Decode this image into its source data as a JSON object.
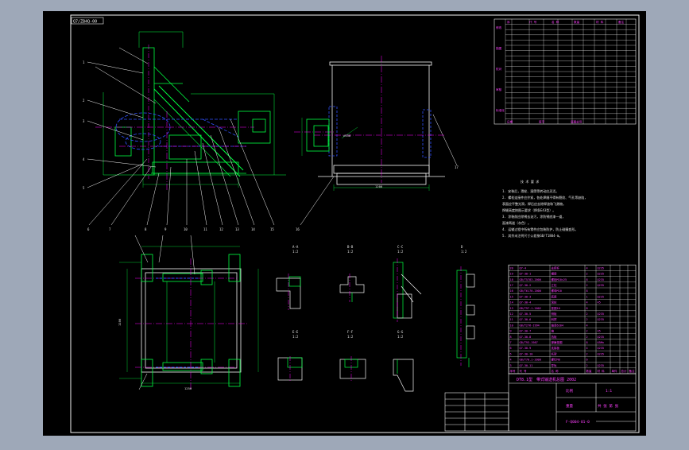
{
  "colors": {
    "window_bg": "#9ea8b8",
    "canvas_bg": "#000000",
    "frame": "#f5f5f5",
    "part": "#00ff40",
    "dim": "#00ff40",
    "hidden": "#3050ff",
    "center": "#ff00ff",
    "text": "#e8e8e8",
    "table": "#f0f0f0",
    "table_text": "#ff40ff",
    "accent": "#ffff00"
  },
  "drawing": {
    "title_tag": "Q7/ZB4Q-00",
    "title_block": {
      "drawing_title": "DT8.1型　带式输送机总图 2002",
      "scale_label": "比例",
      "scale_value": "1:1",
      "sheet_label": "共 张 第 张",
      "drawing_number": "F-Q004-01-0",
      "weight_label": "重量"
    },
    "notes": {
      "heading": "技 术 要 求",
      "lines": [
        "1. 安装后，滑轮、滚筒等转动应灵活。",
        "2. 螺栓连接件应拧紧，各处焊缝不得有裂纹、气孔等缺陷，",
        "   表面应平整光滑，焊后应去除焊渣和飞溅物。",
        "   焊缝高度按图示要求（焊条E43型）。",
        "3. 涂装前应除锈去油污，涂防锈底漆一道，",
        "   面漆两道（灰色）。",
        "4. 运输过程中所有零件应包装防护，防止碰撞变形。",
        "5. 其余未注明尺寸公差按GB/T1804-m。"
      ]
    },
    "section_labels": [
      {
        "id": "A-A",
        "scale": "1:2"
      },
      {
        "id": "B-B",
        "scale": "1:2"
      },
      {
        "id": "C-C",
        "scale": "1:2"
      },
      {
        "id": "D",
        "scale": "1:2"
      },
      {
        "id": "E-E",
        "scale": "1:2"
      },
      {
        "id": "F-F",
        "scale": "1:2"
      },
      {
        "id": "G-G",
        "scale": "1:2"
      }
    ],
    "balloons_top": [
      "1",
      "2",
      "3",
      "4",
      "5",
      "6",
      "7",
      "8",
      "9",
      "10",
      "11",
      "12",
      "13",
      "14",
      "15",
      "16",
      "17",
      "18",
      "19",
      "20"
    ],
    "dimensions": {
      "front_width": "1400",
      "side_width": "1200",
      "plan_height": "1100",
      "plan_width": "1250",
      "side_height": "φ 75",
      "side_gap": "∅150"
    },
    "revision_table": {
      "headers": [
        "序",
        "代 号",
        "名 称",
        "数量",
        "材 料",
        "备注"
      ],
      "groups": [
        "修改",
        "描图",
        "校对",
        "审核",
        "标准化"
      ],
      "footer": [
        "日期",
        "签字",
        "底图总号"
      ]
    },
    "parts_list": {
      "headers": [
        "序号",
        "代 号",
        "名 称",
        "数量",
        "材 料",
        "单件",
        "总计",
        "备注"
      ],
      "rows": [
        [
          "20",
          "Q7-4",
          "支撑杆",
          "4",
          "Q235",
          "",
          "",
          ""
        ],
        [
          "19",
          "Q7-30-1",
          "横梁",
          "2",
          "Q235",
          "",
          "",
          ""
        ],
        [
          "18",
          "GB/T5783-2000",
          "螺栓M10×25",
          "8",
          "Q235",
          "",
          "",
          ""
        ],
        [
          "17",
          "Q7-30-2",
          "立柱",
          "2",
          "Q235",
          "",
          "",
          ""
        ],
        [
          "16",
          "GB/T6170-2000",
          "螺母M10",
          "8",
          "",
          "",
          "",
          ""
        ],
        [
          "15",
          "Q7-30-3",
          "底座",
          "1",
          "Q235",
          "",
          "",
          ""
        ],
        [
          "14",
          "Q7-30-4",
          "滚轮",
          "4",
          "45",
          "",
          "",
          ""
        ],
        [
          "13",
          "GB/T97.1-2002",
          "垫圈10",
          "8",
          "",
          "",
          "",
          ""
        ],
        [
          "12",
          "Q7-30-5",
          "侧板",
          "2",
          "Q235",
          "",
          "",
          ""
        ],
        [
          "11",
          "Q7-30-6",
          "斜撑",
          "2",
          "Q235",
          "",
          "",
          ""
        ],
        [
          "10",
          "GB/T276-1994",
          "轴承6204",
          "4",
          "",
          "",
          "",
          ""
        ],
        [
          "9",
          "Q7-30-7",
          "轴",
          "2",
          "45",
          "",
          "",
          ""
        ],
        [
          "8",
          "Q7-30-8",
          "挡板",
          "2",
          "Q235",
          "",
          "",
          ""
        ],
        [
          "7",
          "GB/T93-1987",
          "弹簧垫圈",
          "8",
          "65Mn",
          "",
          "",
          ""
        ],
        [
          "6",
          "Q7-30-9",
          "连接板",
          "4",
          "Q235",
          "",
          "",
          ""
        ],
        [
          "5",
          "Q7-30-10",
          "托架",
          "2",
          "Q235",
          "",
          "",
          ""
        ],
        [
          "4",
          "GB/T70.1-2000",
          "螺钉M8",
          "6",
          "",
          "",
          "",
          ""
        ],
        [
          "3",
          "Q7-30-11",
          "导轨",
          "2",
          "Q235",
          "",
          "",
          ""
        ]
      ]
    }
  }
}
